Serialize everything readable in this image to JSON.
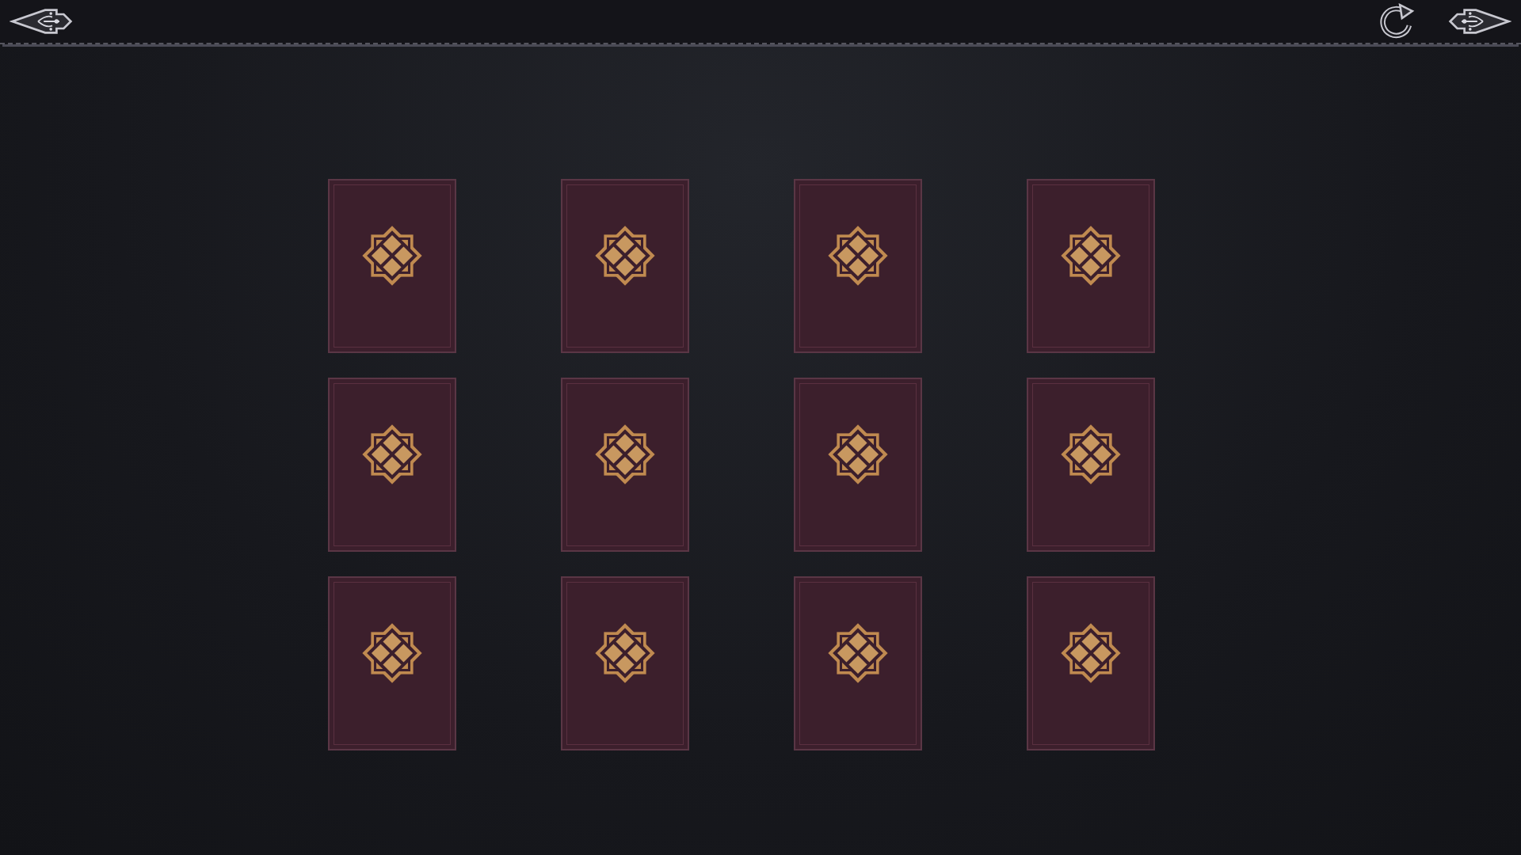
{
  "cards": [
    {
      "face_up": false
    },
    {
      "face_up": false
    },
    {
      "face_up": false
    },
    {
      "face_up": false
    },
    {
      "face_up": false
    },
    {
      "face_up": false
    },
    {
      "face_up": false
    },
    {
      "face_up": false
    },
    {
      "face_up": false
    },
    {
      "face_up": false
    },
    {
      "face_up": false
    },
    {
      "face_up": false
    }
  ]
}
